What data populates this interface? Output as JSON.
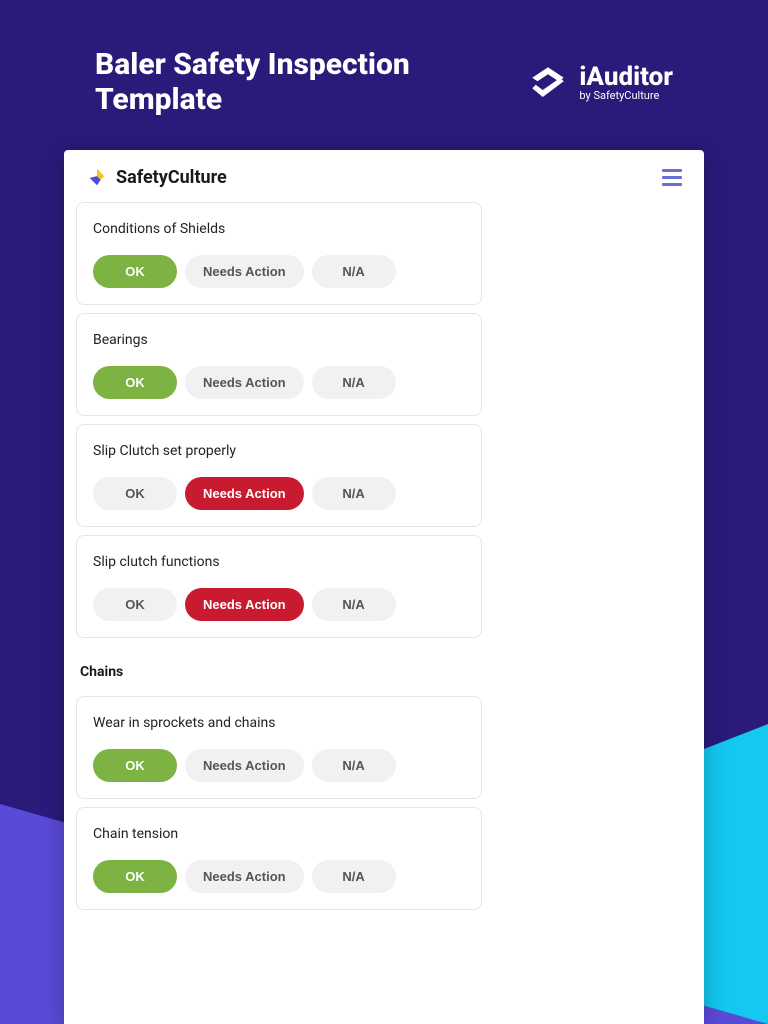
{
  "page_title": "Baler Safety Inspection Template",
  "brand": {
    "name": "iAuditor",
    "byline": "by SafetyCulture"
  },
  "card_brand": "SafetyCulture",
  "options": {
    "ok": "OK",
    "needs_action": "Needs Action",
    "na": "N/A"
  },
  "items": [
    {
      "label": "Conditions of Shields",
      "selected": "ok"
    },
    {
      "label": "Bearings",
      "selected": "ok"
    },
    {
      "label": "Slip Clutch set properly",
      "selected": "needs_action"
    },
    {
      "label": "Slip clutch functions",
      "selected": "needs_action"
    }
  ],
  "section2_title": "Chains",
  "items2": [
    {
      "label": "Wear in sprockets and chains",
      "selected": "ok"
    },
    {
      "label": "Chain tension",
      "selected": "ok"
    }
  ]
}
